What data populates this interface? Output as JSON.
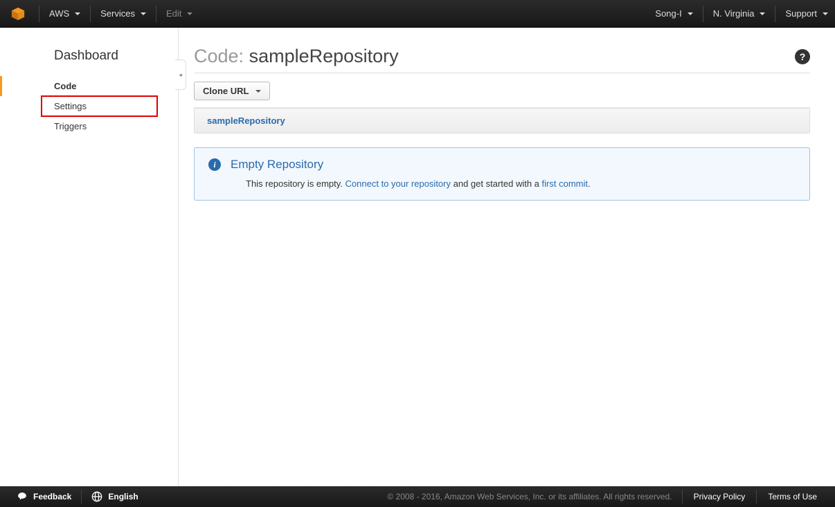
{
  "topnav": {
    "aws": "AWS",
    "services": "Services",
    "edit": "Edit",
    "user": "Song-I",
    "region": "N. Virginia",
    "support": "Support"
  },
  "sidebar": {
    "title": "Dashboard",
    "items": [
      {
        "label": "Code"
      },
      {
        "label": "Settings"
      },
      {
        "label": "Triggers"
      }
    ]
  },
  "page": {
    "title_prefix": "Code: ",
    "title_name": "sampleRepository",
    "clone_btn": "Clone URL",
    "breadcrumb_repo": "sampleRepository"
  },
  "info": {
    "heading": "Empty Repository",
    "text_pre": "This repository is empty. ",
    "link1": "Connect to your repository",
    "text_mid": " and get started with a ",
    "link2": "first commit",
    "text_post": "."
  },
  "footer": {
    "feedback": "Feedback",
    "language": "English",
    "copyright": "© 2008 - 2016, Amazon Web Services, Inc. or its affiliates. All rights reserved.",
    "privacy": "Privacy Policy",
    "terms": "Terms of Use"
  }
}
